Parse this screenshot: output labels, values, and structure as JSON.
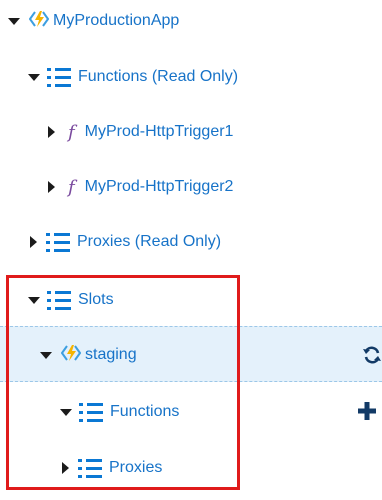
{
  "tree": {
    "app": {
      "label": "MyProductionApp",
      "expanded": true,
      "icon": "function-app-bolt-icon"
    },
    "functions": {
      "label": "Functions (Read Only)",
      "expanded": true,
      "icon": "list-icon"
    },
    "trigger1": {
      "label": "MyProd-HttpTrigger1",
      "icon": "function-f-icon",
      "glyph": "f"
    },
    "trigger2": {
      "label": "MyProd-HttpTrigger2",
      "icon": "function-f-icon",
      "glyph": "f"
    },
    "proxies": {
      "label": "Proxies (Read Only)",
      "expanded": false,
      "icon": "list-icon"
    },
    "slots": {
      "label": "Slots",
      "expanded": true,
      "icon": "list-icon"
    },
    "staging": {
      "label": "staging",
      "expanded": true,
      "selected": true,
      "icon": "function-app-bolt-icon"
    },
    "slot_functions": {
      "label": "Functions",
      "expanded": true,
      "icon": "list-icon"
    },
    "slot_proxies": {
      "label": "Proxies",
      "expanded": false,
      "icon": "list-icon"
    }
  },
  "actions": {
    "refresh": {
      "icon": "refresh-icon"
    },
    "add": {
      "icon": "plus-icon"
    }
  },
  "colors": {
    "link_blue": "#1773c8",
    "list_blue": "#0a78d4",
    "bolt_yellow": "#f5b400",
    "bolt_blue": "#3d9fe0",
    "highlight_box": "#e01b1b",
    "selected_bg": "#e4f1fb"
  }
}
